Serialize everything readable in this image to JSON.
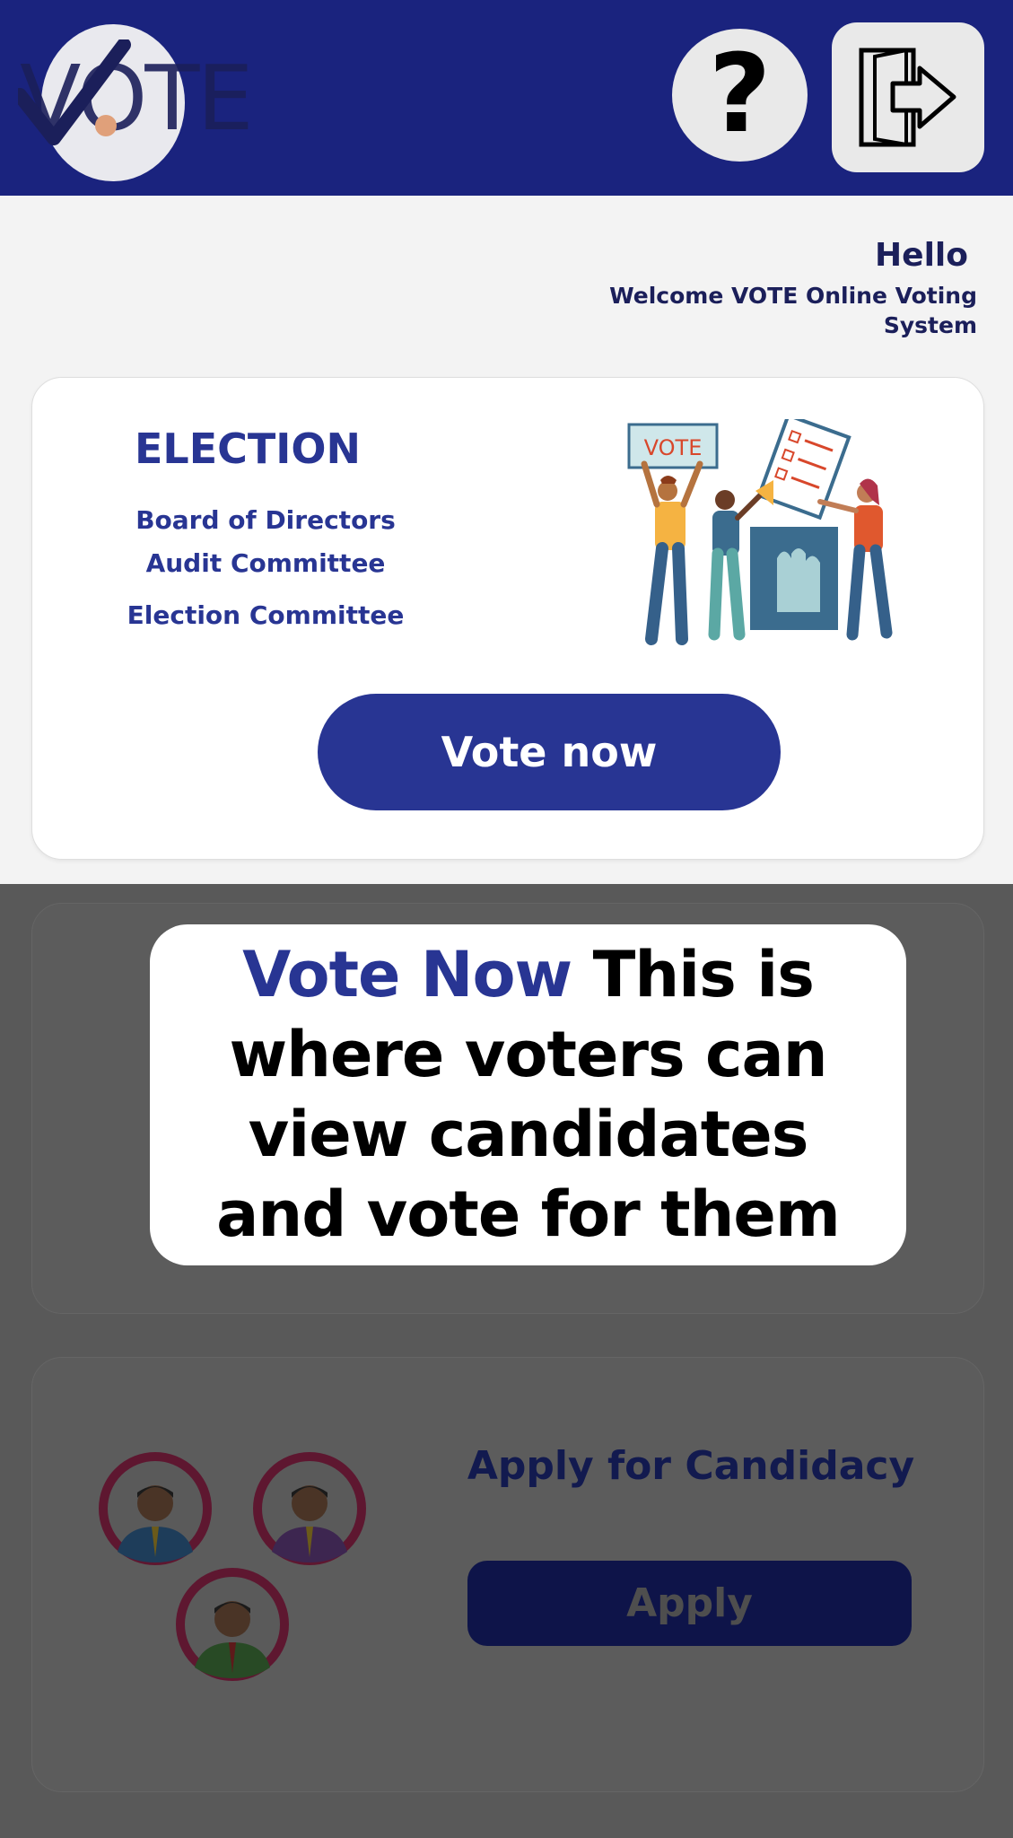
{
  "header": {
    "logo_text": "VOTE",
    "help_label": "?"
  },
  "greeting": {
    "hello": "Hello",
    "welcome": "Welcome VOTE Online Voting System"
  },
  "election_card": {
    "title": "ELECTION",
    "committees": [
      "Board of Directors",
      "Audit Committee",
      "Election Committee"
    ],
    "illustration_sign": "VOTE",
    "button_label": "Vote now"
  },
  "tooltip": {
    "highlight": "Vote Now",
    "text": "This is where voters can view candidates and vote for them"
  },
  "candidacy_card": {
    "title": "Apply for Candidacy",
    "button_label": "Apply"
  },
  "colors": {
    "brand": "#283593",
    "header": "#1a237e",
    "overlay": "#595959"
  }
}
